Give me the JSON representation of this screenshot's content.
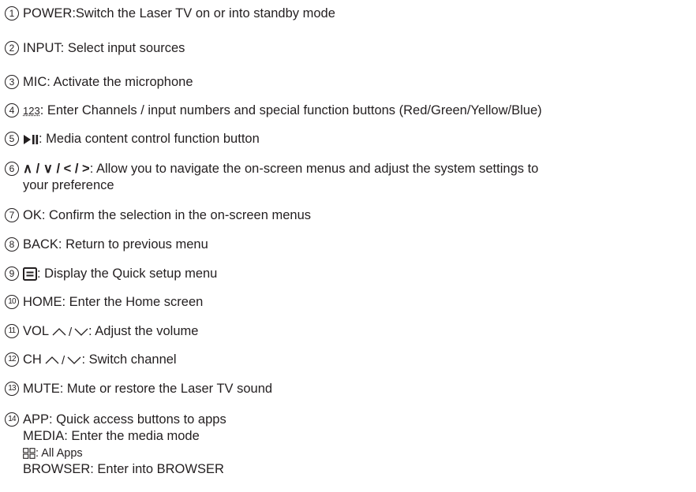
{
  "items": [
    {
      "num": "1",
      "text": "POWER:Switch the Laser TV on or into standby mode"
    },
    {
      "num": "2",
      "text": "INPUT: Select input sources"
    },
    {
      "num": "3",
      "text": "MIC: Activate the microphone"
    },
    {
      "num": "4",
      "symbol_text": "123",
      "text": ": Enter Channels / input numbers and special function buttons (Red/Green/Yellow/Blue)"
    },
    {
      "num": "5",
      "symbol": "play-pause-icon",
      "text": ": Media content control function button"
    },
    {
      "num": "6",
      "symbol_text": "∧ / ∨ / < / >",
      "text": ": Allow you to navigate the on-screen menus and adjust the system settings to",
      "text2": "your preference"
    },
    {
      "num": "7",
      "text": "OK: Confirm the selection in the on-screen menus"
    },
    {
      "num": "8",
      "text": "BACK: Return to previous menu"
    },
    {
      "num": "9",
      "symbol": "menu-box-icon",
      "text": ": Display the Quick setup menu"
    },
    {
      "num": "10",
      "text": "HOME: Enter the Home screen"
    },
    {
      "num": "11",
      "prefix": "VOL",
      "symbol": "up-down-chevron-icon",
      "text": ": Adjust the volume"
    },
    {
      "num": "12",
      "prefix": "CH",
      "symbol": "up-down-chevron-icon",
      "text": ": Switch channel"
    },
    {
      "num": "13",
      "text": "MUTE: Mute or restore the Laser TV sound"
    },
    {
      "num": "14",
      "text": "APP: Quick access buttons to apps"
    }
  ],
  "app_sub": [
    {
      "text": "MEDIA: Enter the media mode"
    },
    {
      "symbol": "all-apps-grid-icon",
      "text": ": All Apps"
    },
    {
      "text": "BROWSER: Enter into BROWSER"
    }
  ]
}
